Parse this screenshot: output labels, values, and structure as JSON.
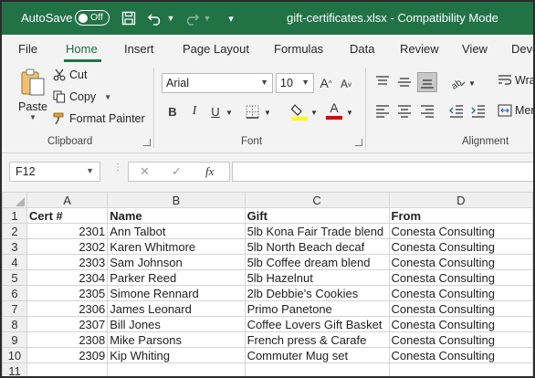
{
  "titlebar": {
    "autosave_label": "AutoSave",
    "autosave_state": "Off",
    "document_title": "gift-certificates.xlsx  -  Compatibility Mode"
  },
  "ribbon_tabs": [
    "File",
    "Home",
    "Insert",
    "Page Layout",
    "Formulas",
    "Data",
    "Review",
    "View",
    "Deve"
  ],
  "active_tab": "Home",
  "clipboard": {
    "paste_label": "Paste",
    "cut_label": "Cut",
    "copy_label": "Copy",
    "format_painter_label": "Format Painter",
    "group_label": "Clipboard"
  },
  "font": {
    "font_name": "Arial",
    "font_size": "10",
    "bold": "B",
    "italic": "I",
    "underline": "U",
    "grow_font": "A",
    "shrink_font": "A",
    "font_color_glyph": "A",
    "group_label": "Font",
    "highlight_color": "#ffff00",
    "font_color": "#e00000"
  },
  "alignment": {
    "wrap_label": "Wra",
    "merge_label": "Mer",
    "group_label": "Alignment"
  },
  "formula_bar": {
    "name_box": "F12",
    "fx_label": "fx",
    "formula_value": ""
  },
  "sheet": {
    "column_headers": [
      "A",
      "B",
      "C",
      "D"
    ],
    "rows": [
      {
        "num": "1",
        "cells": [
          "Cert #",
          "Name",
          "Gift",
          "From"
        ]
      },
      {
        "num": "2",
        "cells": [
          "2301",
          "Ann Talbot",
          "5lb Kona Fair Trade blend",
          "Conesta Consulting"
        ]
      },
      {
        "num": "3",
        "cells": [
          "2302",
          "Karen Whitmore",
          "5lb North Beach decaf",
          "Conesta Consulting"
        ]
      },
      {
        "num": "4",
        "cells": [
          "2303",
          "Sam Johnson",
          "5lb Coffee dream blend",
          "Conesta Consulting"
        ]
      },
      {
        "num": "5",
        "cells": [
          "2304",
          "Parker Reed",
          "5lb Hazelnut",
          "Conesta Consulting"
        ]
      },
      {
        "num": "6",
        "cells": [
          "2305",
          "Simone Rennard",
          "2lb Debbie's Cookies",
          "Conesta Consulting"
        ]
      },
      {
        "num": "7",
        "cells": [
          "2306",
          "James Leonard",
          "Primo Panetone",
          "Conesta Consulting"
        ]
      },
      {
        "num": "8",
        "cells": [
          "2307",
          "Bill Jones",
          "Coffee Lovers Gift Basket",
          "Conesta Consulting"
        ]
      },
      {
        "num": "9",
        "cells": [
          "2308",
          "Mike Parsons",
          "French press & Carafe",
          "Conesta Consulting"
        ]
      },
      {
        "num": "10",
        "cells": [
          "2309",
          "Kip Whiting",
          "Commuter Mug set",
          "Conesta Consulting"
        ]
      },
      {
        "num": "11",
        "cells": [
          "",
          "",
          "",
          ""
        ]
      }
    ]
  },
  "colors": {
    "brand_green": "#217346"
  }
}
